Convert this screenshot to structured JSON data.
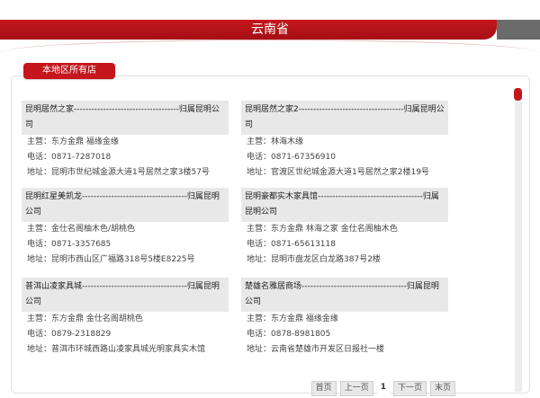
{
  "header": {
    "title": "云南省"
  },
  "section": {
    "title": "本地区所有店"
  },
  "labels": {
    "business": "主营：",
    "phone": "电话：",
    "address": "地址："
  },
  "stores": [
    {
      "name": "昆明居然之家------------------------------------归属昆明公司",
      "business": "东方金鼎 福缘金缘",
      "phone": "0871-7287018",
      "address": "昆明市世纪城金源大道1号居然之家3楼57号"
    },
    {
      "name": "昆明居然之家2------------------------------------归属昆明公司",
      "business": "林海木缘",
      "phone": "0871-67356910",
      "address": "官渡区世纪城金源大道1号居然之家2楼19号"
    },
    {
      "name": "昆明红星美凯龙------------------------------------归属昆明公司",
      "business": "金仕名阁柚木色/胡桃色",
      "phone": "0871-3357685",
      "address": "昆明市西山区广福路318号5楼E8225号"
    },
    {
      "name": "昆明豪都实木家具馆------------------------------------归属昆明公司",
      "business": "东方金鼎 林海之家 金仕名阁柚木色",
      "phone": "0871-65613118",
      "address": "昆明市盘龙区白龙路387号2楼"
    },
    {
      "name": "普洱山凌家具城------------------------------------归属昆明公司",
      "business": "东方金鼎 金仕名阁胡桃色",
      "phone": "0879-2318829",
      "address": "普洱市环城西路山凌家具城光明家具实木馆"
    },
    {
      "name": "楚雄名雅居商场------------------------------------归属昆明公司",
      "business": "东方金鼎 福缘金缘",
      "phone": "0878-8981805",
      "address": "云南省楚雄市开发区日报社一楼"
    }
  ],
  "pager": {
    "first": "首页",
    "prev": "上一页",
    "current": "1",
    "next": "下一页",
    "last": "末页"
  }
}
